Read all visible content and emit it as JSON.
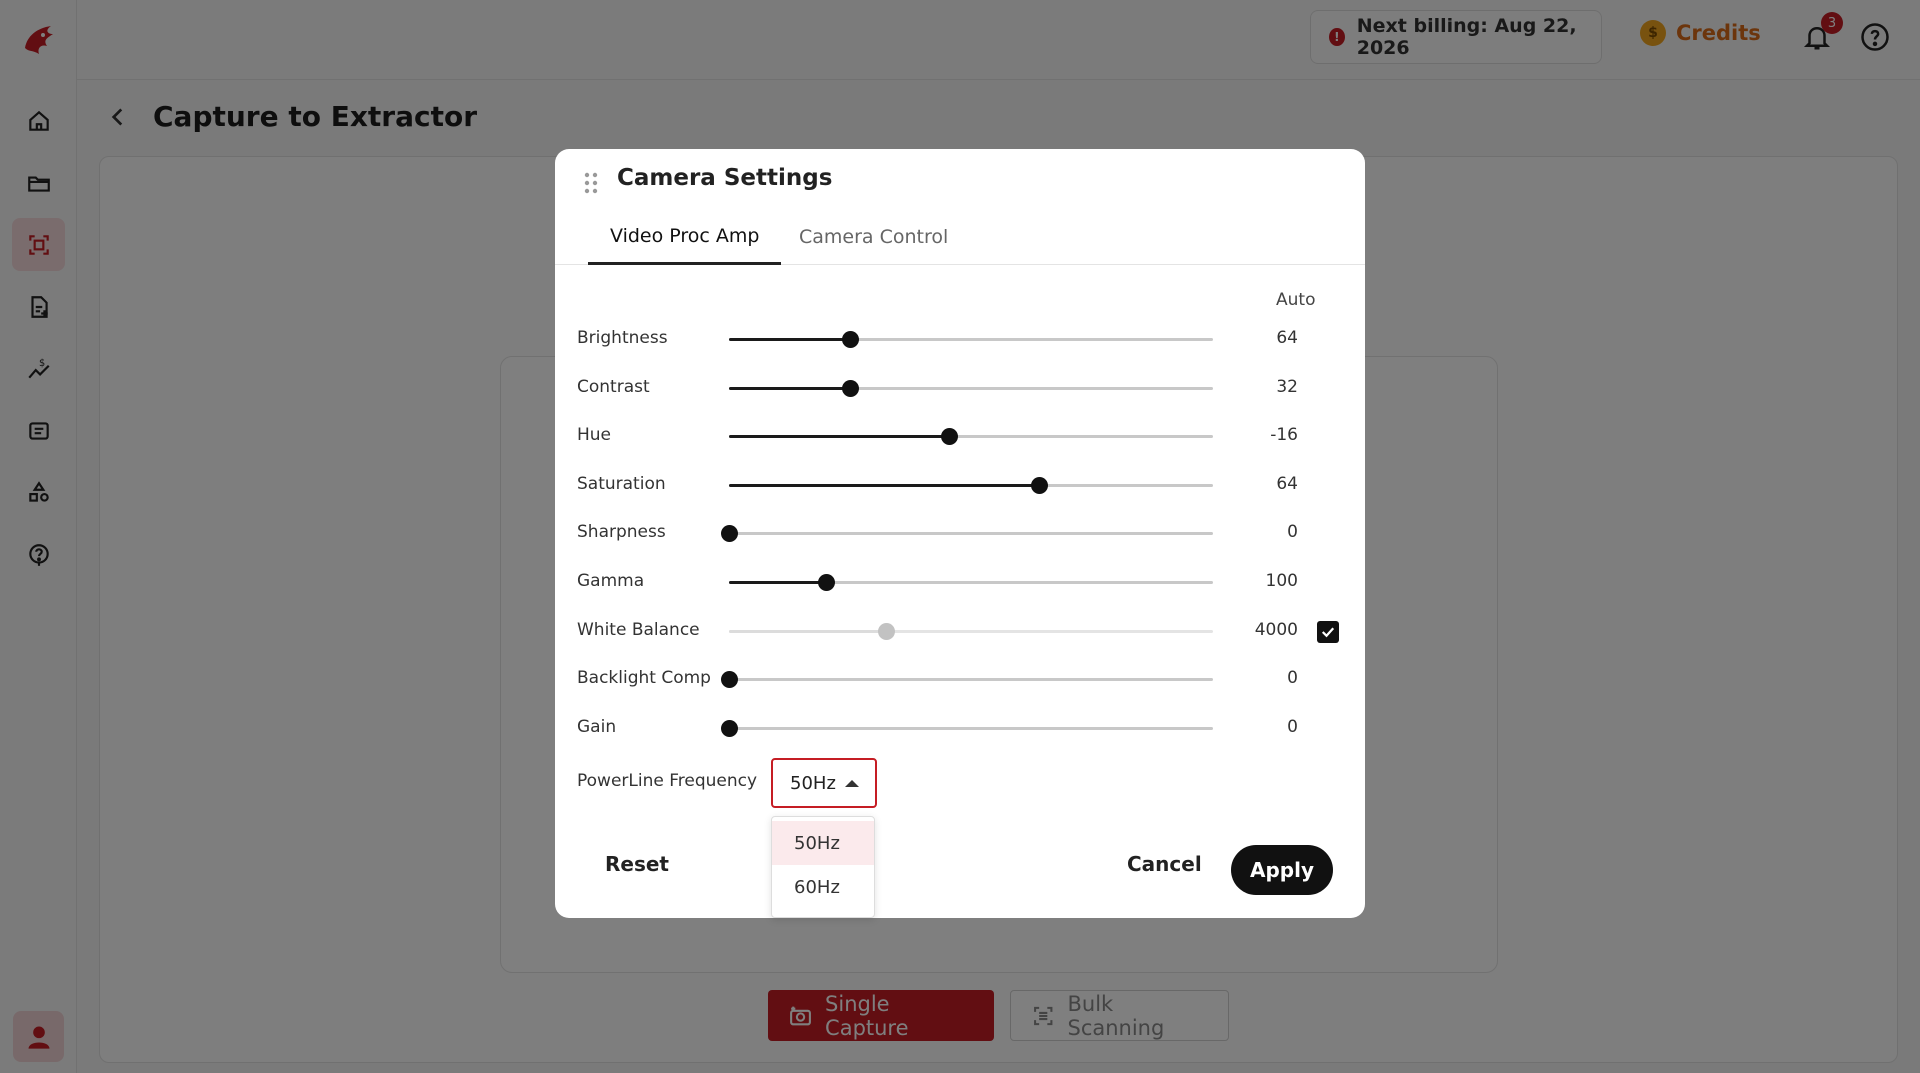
{
  "header": {
    "billing_text": "Next billing: Aug 22, 2026",
    "credits_label": "Credits",
    "notification_count": "3"
  },
  "sidebar": {
    "items": [
      {
        "icon": "home-icon"
      },
      {
        "icon": "folder-icon"
      },
      {
        "icon": "scan-icon",
        "active": true
      },
      {
        "icon": "document-add-icon"
      },
      {
        "icon": "pricing-chart-icon"
      },
      {
        "icon": "list-icon"
      },
      {
        "icon": "shapes-icon"
      },
      {
        "icon": "help-icon"
      }
    ]
  },
  "page": {
    "title": "Capture to Extractor",
    "single_capture_label": "Single Capture",
    "bulk_scanning_label": "Bulk Scanning"
  },
  "modal": {
    "title": "Camera Settings",
    "tabs": [
      "Video Proc Amp",
      "Camera Control"
    ],
    "active_tab": "Video Proc Amp",
    "auto_label": "Auto",
    "sliders": [
      {
        "label": "Brightness",
        "value": "64",
        "fraction": 0.25,
        "disabled": false
      },
      {
        "label": "Contrast",
        "value": "32",
        "fraction": 0.25,
        "disabled": false
      },
      {
        "label": "Hue",
        "value": "-16",
        "fraction": 0.455,
        "disabled": false
      },
      {
        "label": "Saturation",
        "value": "64",
        "fraction": 0.64,
        "disabled": false
      },
      {
        "label": "Sharpness",
        "value": "0",
        "fraction": 0.0,
        "disabled": false
      },
      {
        "label": "Gamma",
        "value": "100",
        "fraction": 0.2,
        "disabled": false
      },
      {
        "label": "White Balance",
        "value": "4000",
        "fraction": 0.325,
        "disabled": true,
        "auto_checked": true
      },
      {
        "label": "Backlight Comp",
        "value": "0",
        "fraction": 0.0,
        "disabled": false
      },
      {
        "label": "Gain",
        "value": "0",
        "fraction": 0.0,
        "disabled": false
      }
    ],
    "powerline_label": "PowerLine Frequency",
    "powerline_value": "50Hz",
    "powerline_options": [
      "50Hz",
      "60Hz"
    ],
    "reset_label": "Reset",
    "cancel_label": "Cancel",
    "apply_label": "Apply"
  },
  "colors": {
    "brand_red": "#c51d24",
    "credits_orange": "#d86a18"
  }
}
